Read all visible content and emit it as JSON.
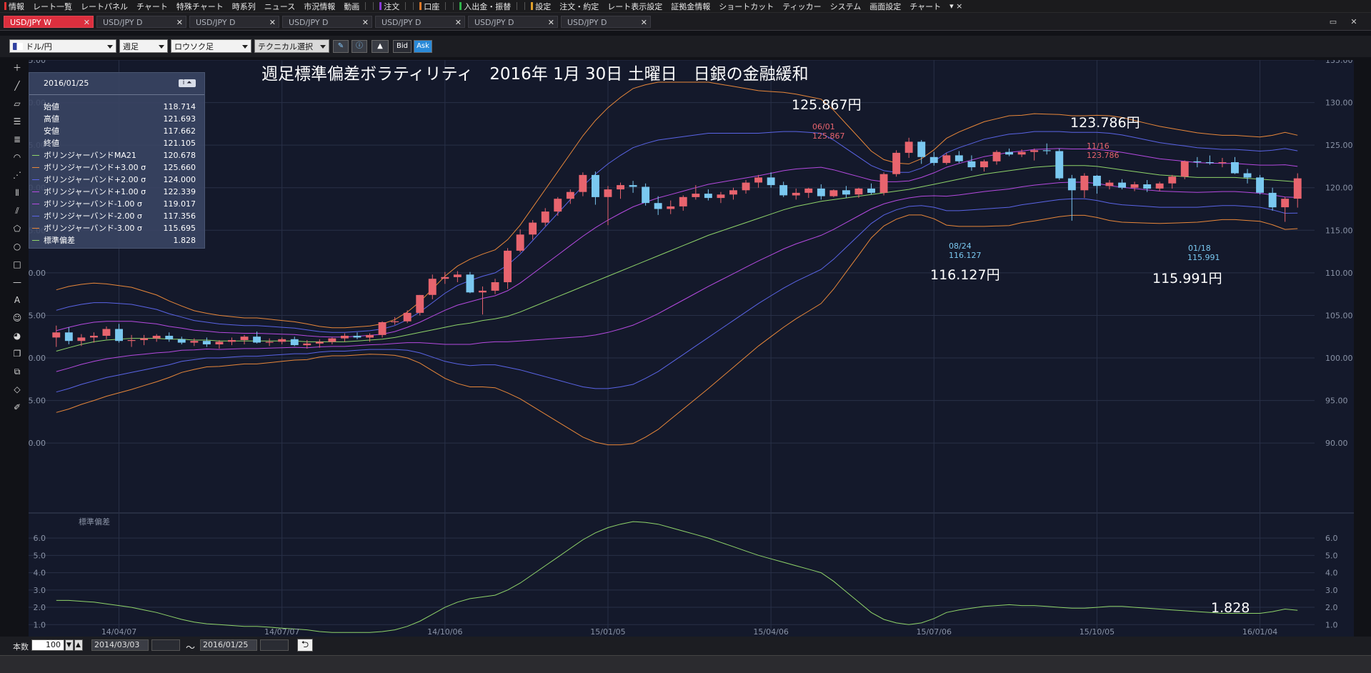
{
  "menubar": [
    {
      "label": "情報",
      "color": "#d33"
    },
    {
      "label": "レート一覧"
    },
    {
      "label": "レートパネル"
    },
    {
      "label": "チャート"
    },
    {
      "label": "特殊チャート"
    },
    {
      "label": "時系列"
    },
    {
      "label": "ニュース"
    },
    {
      "label": "市況情報"
    },
    {
      "label": "動画"
    },
    {
      "label": "注文",
      "color": "#8a3bd8",
      "sep": true
    },
    {
      "label": "口座",
      "color": "#e07a2a",
      "sep": true
    },
    {
      "label": "入出金・振替",
      "color": "#2fb34a",
      "sep": true
    },
    {
      "label": "設定",
      "color": "#e0a02a",
      "sep": true
    },
    {
      "label": "注文・約定"
    },
    {
      "label": "レート表示設定"
    },
    {
      "label": "証拠金情報"
    },
    {
      "label": "ショートカット"
    },
    {
      "label": "ティッカー"
    },
    {
      "label": "システム"
    },
    {
      "label": "画面設定"
    },
    {
      "label": "チャート"
    },
    {
      "label": "▾ ×"
    }
  ],
  "tabs": [
    "USD/JPY W",
    "USD/JPY D",
    "USD/JPY D",
    "USD/JPY D",
    "USD/JPY D",
    "USD/JPY D",
    "USD/JPY D"
  ],
  "toolbar": {
    "pair": "ドル/円",
    "period": "週足",
    "chart_type": "ロウソク足",
    "technical": "テクニカル選択",
    "bid": "Bid",
    "ask": "Ask"
  },
  "chart": {
    "title": "週足標準偏差ボラティリティ　2016年 1月 30日 土曜日　日銀の金融緩和",
    "annotations": {
      "high1_big": "125.867円",
      "high1_date": "06/01",
      "high1_val": "125.867",
      "high2_big": "123.786円",
      "high2_date": "11/16",
      "high2_val": "123.786",
      "low1_big": "116.127円",
      "low1_date": "08/24",
      "low1_val": "116.127",
      "low2_big": "115.991円",
      "low2_date": "01/18",
      "low2_val": "115.991"
    },
    "sub_label": "標準偏差",
    "sub_value": "1.828"
  },
  "info": {
    "date": "2016/01/25",
    "rows": [
      {
        "label": "始値",
        "value": "118.714",
        "color": ""
      },
      {
        "label": "高値",
        "value": "121.693",
        "color": ""
      },
      {
        "label": "安値",
        "value": "117.662",
        "color": ""
      },
      {
        "label": "終値",
        "value": "121.105",
        "color": ""
      },
      {
        "label": "ボリンジャーバンドMA21",
        "value": "120.678",
        "color": "#8fd46a"
      },
      {
        "label": "ボリンジャーバンド+3.00 σ",
        "value": "125.660",
        "color": "#e8873a"
      },
      {
        "label": "ボリンジャーバンド+2.00 σ",
        "value": "124.000",
        "color": "#5a64e6"
      },
      {
        "label": "ボリンジャーバンド+1.00 σ",
        "value": "122.339",
        "color": "#b54ae0"
      },
      {
        "label": "ボリンジャーバンド-1.00 σ",
        "value": "119.017",
        "color": "#b54ae0"
      },
      {
        "label": "ボリンジャーバンド-2.00 σ",
        "value": "117.356",
        "color": "#5a64e6"
      },
      {
        "label": "ボリンジャーバンド-3.00 σ",
        "value": "115.695",
        "color": "#e8873a"
      },
      {
        "label": "標準偏差",
        "value": "1.828",
        "color": "#8fd46a"
      }
    ]
  },
  "bottombar": {
    "count_label": "本数",
    "count_value": "100",
    "from_date": "2014/03/03",
    "tilde": "～",
    "to_date": "2016/01/25"
  },
  "chart_data": {
    "type": "line",
    "main": {
      "y_range": [
        88,
        135
      ],
      "y_ticks": [
        "135.00",
        "130.00",
        "125.00",
        "120.00",
        "115.00",
        "110.00",
        "105.00",
        "100.00",
        "95.00",
        "90.00"
      ],
      "x_ticks": [
        "14/04/07",
        "14/07/07",
        "14/10/06",
        "15/01/05",
        "15/04/06",
        "15/07/06",
        "15/10/05",
        "16/01/04"
      ],
      "weeks": 100,
      "candles": [
        [
          102.4,
          103.8,
          101.3,
          103.0
        ],
        [
          103.0,
          103.6,
          101.6,
          102.0
        ],
        [
          102.0,
          102.8,
          101.4,
          102.4
        ],
        [
          102.4,
          103.0,
          101.8,
          102.6
        ],
        [
          102.6,
          103.7,
          102.2,
          103.4
        ],
        [
          103.4,
          104.0,
          101.8,
          102.0
        ],
        [
          102.0,
          102.7,
          101.3,
          102.1
        ],
        [
          102.1,
          102.7,
          101.5,
          102.3
        ],
        [
          102.3,
          102.8,
          101.9,
          102.6
        ],
        [
          102.6,
          103.0,
          101.9,
          102.2
        ],
        [
          102.2,
          102.5,
          101.6,
          101.8
        ],
        [
          101.8,
          102.3,
          101.4,
          102.0
        ],
        [
          102.0,
          102.4,
          101.3,
          101.6
        ],
        [
          101.6,
          102.1,
          101.1,
          101.9
        ],
        [
          101.9,
          102.4,
          101.5,
          102.1
        ],
        [
          102.1,
          102.7,
          101.6,
          102.5
        ],
        [
          102.5,
          103.1,
          101.7,
          101.8
        ],
        [
          101.8,
          102.3,
          101.4,
          101.9
        ],
        [
          101.9,
          102.4,
          101.6,
          102.2
        ],
        [
          102.2,
          102.5,
          101.4,
          101.5
        ],
        [
          101.5,
          102.1,
          101.1,
          101.7
        ],
        [
          101.7,
          102.2,
          101.2,
          101.9
        ],
        [
          101.9,
          102.4,
          101.6,
          102.3
        ],
        [
          102.3,
          102.9,
          101.9,
          102.6
        ],
        [
          102.6,
          103.0,
          102.2,
          102.4
        ],
        [
          102.4,
          102.9,
          101.9,
          102.7
        ],
        [
          102.7,
          104.3,
          102.4,
          104.2
        ],
        [
          104.2,
          104.8,
          103.9,
          104.3
        ],
        [
          104.3,
          105.6,
          104.1,
          105.3
        ],
        [
          105.3,
          107.4,
          105.0,
          107.4
        ],
        [
          107.4,
          109.8,
          106.9,
          109.3
        ],
        [
          109.3,
          110.1,
          108.7,
          109.5
        ],
        [
          109.5,
          110.2,
          108.9,
          109.8
        ],
        [
          109.8,
          110.1,
          107.6,
          107.7
        ],
        [
          107.7,
          108.4,
          105.1,
          107.9
        ],
        [
          107.9,
          109.3,
          107.5,
          108.9
        ],
        [
          108.9,
          112.9,
          108.1,
          112.6
        ],
        [
          112.6,
          115.1,
          112.4,
          114.5
        ],
        [
          114.5,
          116.2,
          113.9,
          115.9
        ],
        [
          115.9,
          117.6,
          115.5,
          117.2
        ],
        [
          117.2,
          118.9,
          116.7,
          118.7
        ],
        [
          118.7,
          119.8,
          118.1,
          119.5
        ],
        [
          119.5,
          121.8,
          119.0,
          121.5
        ],
        [
          121.5,
          121.9,
          118.0,
          118.9
        ],
        [
          118.9,
          120.2,
          115.6,
          119.8
        ],
        [
          119.8,
          120.6,
          118.7,
          120.3
        ],
        [
          120.3,
          120.8,
          119.4,
          120.1
        ],
        [
          120.1,
          120.5,
          117.9,
          118.2
        ],
        [
          118.2,
          119.0,
          116.8,
          117.5
        ],
        [
          117.5,
          118.5,
          116.9,
          117.8
        ],
        [
          117.8,
          119.1,
          117.3,
          118.9
        ],
        [
          118.9,
          120.3,
          118.6,
          119.3
        ],
        [
          119.3,
          119.8,
          118.5,
          118.8
        ],
        [
          118.8,
          119.5,
          118.2,
          119.2
        ],
        [
          119.2,
          120.0,
          118.6,
          119.7
        ],
        [
          119.7,
          120.9,
          119.3,
          120.6
        ],
        [
          120.6,
          121.5,
          120.0,
          121.2
        ],
        [
          121.2,
          121.8,
          120.0,
          120.3
        ],
        [
          120.3,
          120.7,
          118.9,
          119.1
        ],
        [
          119.1,
          119.9,
          118.6,
          119.4
        ],
        [
          119.4,
          120.0,
          118.8,
          119.9
        ],
        [
          119.9,
          120.4,
          118.6,
          119.0
        ],
        [
          119.0,
          119.8,
          118.9,
          119.7
        ],
        [
          119.7,
          120.2,
          118.8,
          119.2
        ],
        [
          119.2,
          120.0,
          118.8,
          119.9
        ],
        [
          119.9,
          120.5,
          119.2,
          119.4
        ],
        [
          119.4,
          121.8,
          119.1,
          121.6
        ],
        [
          121.6,
          124.4,
          121.3,
          124.1
        ],
        [
          124.1,
          125.867,
          123.5,
          125.4
        ],
        [
          125.4,
          125.6,
          122.8,
          123.6
        ],
        [
          123.6,
          124.2,
          122.6,
          122.9
        ],
        [
          122.9,
          124.1,
          122.7,
          123.8
        ],
        [
          123.8,
          124.3,
          122.9,
          123.1
        ],
        [
          123.1,
          123.8,
          122.0,
          122.4
        ],
        [
          122.4,
          123.3,
          121.9,
          123.1
        ],
        [
          123.1,
          124.4,
          122.7,
          124.2
        ],
        [
          124.2,
          124.6,
          123.7,
          123.9
        ],
        [
          123.9,
          124.5,
          123.6,
          124.2
        ],
        [
          124.2,
          124.6,
          123.2,
          124.4
        ],
        [
          124.4,
          125.2,
          123.9,
          124.3
        ],
        [
          124.3,
          124.6,
          120.9,
          121.1
        ],
        [
          121.1,
          121.5,
          116.127,
          119.7
        ],
        [
          119.7,
          121.7,
          118.8,
          121.4
        ],
        [
          121.4,
          121.5,
          119.3,
          120.2
        ],
        [
          120.2,
          120.9,
          119.8,
          120.6
        ],
        [
          120.6,
          121.0,
          119.8,
          120.0
        ],
        [
          120.0,
          120.7,
          119.6,
          120.4
        ],
        [
          120.4,
          120.9,
          119.5,
          119.9
        ],
        [
          119.9,
          120.7,
          119.6,
          120.5
        ],
        [
          120.5,
          121.5,
          119.9,
          121.3
        ],
        [
          121.3,
          123.2,
          121.0,
          123.1
        ],
        [
          123.1,
          123.6,
          122.4,
          123.0
        ],
        [
          123.0,
          123.786,
          122.7,
          122.9
        ],
        [
          122.9,
          123.5,
          122.4,
          123.0
        ],
        [
          123.0,
          123.6,
          121.6,
          121.7
        ],
        [
          121.7,
          122.2,
          120.5,
          121.2
        ],
        [
          121.2,
          121.5,
          119.2,
          119.4
        ],
        [
          119.4,
          120.0,
          117.3,
          117.7
        ],
        [
          117.7,
          118.9,
          115.991,
          118.7
        ],
        [
          118.714,
          121.693,
          117.662,
          121.105
        ]
      ],
      "bands": {
        "ma21": [
          100.8,
          101.2,
          101.6,
          101.9,
          102.1,
          102.2,
          102.3,
          102.3,
          102.3,
          102.2,
          102.2,
          102.1,
          102.1,
          102.0,
          102.0,
          102.0,
          102.0,
          102.0,
          102.0,
          102.0,
          101.9,
          101.9,
          101.9,
          101.9,
          102.0,
          102.1,
          102.2,
          102.4,
          102.7,
          103.0,
          103.3,
          103.6,
          103.9,
          104.1,
          104.4,
          104.6,
          104.9,
          105.4,
          106.0,
          106.6,
          107.2,
          107.8,
          108.4,
          109.0,
          109.6,
          110.2,
          110.8,
          111.4,
          112.0,
          112.6,
          113.2,
          113.8,
          114.4,
          114.9,
          115.4,
          115.9,
          116.4,
          116.9,
          117.4,
          117.8,
          118.1,
          118.4,
          118.6,
          118.8,
          119.0,
          119.2,
          119.4,
          119.6,
          119.8,
          120.1,
          120.4,
          120.7,
          121.0,
          121.3,
          121.6,
          121.8,
          122.0,
          122.2,
          122.4,
          122.5,
          122.6,
          122.6,
          122.6,
          122.5,
          122.3,
          122.1,
          121.9,
          121.7,
          121.5,
          121.4,
          121.3,
          121.2,
          121.2,
          121.2,
          121.2,
          121.1,
          121.0,
          120.9,
          120.8,
          120.678
        ],
        "sd": [
          2.4,
          2.4,
          2.35,
          2.3,
          2.2,
          2.1,
          2.0,
          1.85,
          1.7,
          1.5,
          1.3,
          1.15,
          1.05,
          1.0,
          0.95,
          0.9,
          0.9,
          0.85,
          0.8,
          0.75,
          0.7,
          0.6,
          0.55,
          0.55,
          0.55,
          0.55,
          0.6,
          0.7,
          0.9,
          1.2,
          1.6,
          2.0,
          2.3,
          2.5,
          2.6,
          2.7,
          3.0,
          3.4,
          3.9,
          4.4,
          4.9,
          5.4,
          5.9,
          6.3,
          6.6,
          6.8,
          6.95,
          6.9,
          6.8,
          6.6,
          6.4,
          6.2,
          6.0,
          5.75,
          5.5,
          5.25,
          5.0,
          4.8,
          4.6,
          4.4,
          4.2,
          4.0,
          3.5,
          2.9,
          2.3,
          1.7,
          1.3,
          1.1,
          1.0,
          1.1,
          1.35,
          1.7,
          1.85,
          1.95,
          2.05,
          2.1,
          2.15,
          2.1,
          2.1,
          2.05,
          2.0,
          1.95,
          1.95,
          2.0,
          2.05,
          2.05,
          2.0,
          1.95,
          1.9,
          1.85,
          1.8,
          1.75,
          1.7,
          1.65,
          1.65,
          1.65,
          1.65,
          1.75,
          1.9,
          1.828
        ]
      }
    },
    "sub": {
      "label": "標準偏差",
      "y_range": [
        0.6,
        7.2
      ],
      "y_ticks": [
        "6.0",
        "5.0",
        "4.0",
        "3.0",
        "2.0",
        "1.0"
      ]
    },
    "colors": {
      "up": "#e8646e",
      "down": "#7ac8f0",
      "ma21": "#8fd46a",
      "s1": "#b54ae0",
      "s2": "#5a64e6",
      "s3": "#e8873a",
      "grid": "#283047",
      "axis_text": "#8a93a6"
    }
  }
}
